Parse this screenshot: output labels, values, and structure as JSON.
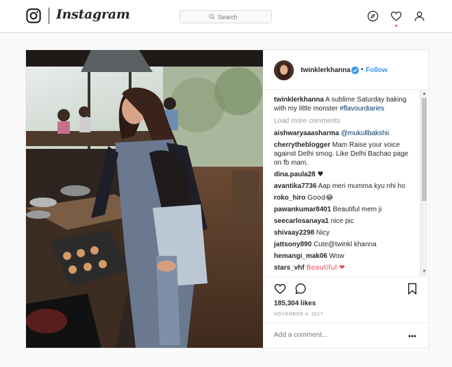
{
  "nav": {
    "logo_icon": "instagram-camera-icon",
    "wordmark": "Instagram",
    "search_placeholder": "Search",
    "icons": [
      "explore-compass-icon",
      "activity-heart-icon",
      "profile-icon"
    ]
  },
  "post": {
    "username": "twinklerkhanna",
    "dot": "•",
    "follow": "Follow",
    "caption": {
      "username": "twinklerkhanna",
      "text": "A sublime Saturday baking with my little monster",
      "hashtag": "#flavourdiaries"
    },
    "load_more": "Load more comments",
    "comments": [
      {
        "user": "aishwaryaaasharma",
        "text": "",
        "mention": "@mukullbakshii"
      },
      {
        "user": "cherrytheblogger",
        "text": "Mam Raise your voice against Delhi smog. Like Delhi Bachao page on fb mam.",
        "mention": ""
      },
      {
        "user": "dina.paula28",
        "text": "♥",
        "mention": ""
      },
      {
        "user": "avantika7736",
        "text": "Aap meri mumma kyu nhi ho",
        "mention": ""
      },
      {
        "user": "roko_hiro",
        "text": "Good😂",
        "mention": ""
      },
      {
        "user": "pawankumar8401",
        "text": "Beautiful mem ji",
        "mention": ""
      },
      {
        "user": "seecarlosanaya1",
        "text": "nice pic",
        "mention": ""
      },
      {
        "user": "shivaay2298",
        "text": "Nicy",
        "mention": ""
      },
      {
        "user": "jattsony890",
        "text": "Cute@twinkl khanna",
        "mention": ""
      },
      {
        "user": "hemangi_mak06",
        "text": "Wow",
        "mention": ""
      },
      {
        "user": "stars_vhf",
        "text": "Beautiful ❤",
        "mention": ""
      }
    ],
    "likes": "185,304 likes",
    "date": "NOVEMBER 4, 2017",
    "add_comment_placeholder": "Add a comment...",
    "colors": {
      "link": "#3897f0",
      "verified": "#3897f0",
      "heart": "#ed4956",
      "muted": "#999999"
    }
  }
}
